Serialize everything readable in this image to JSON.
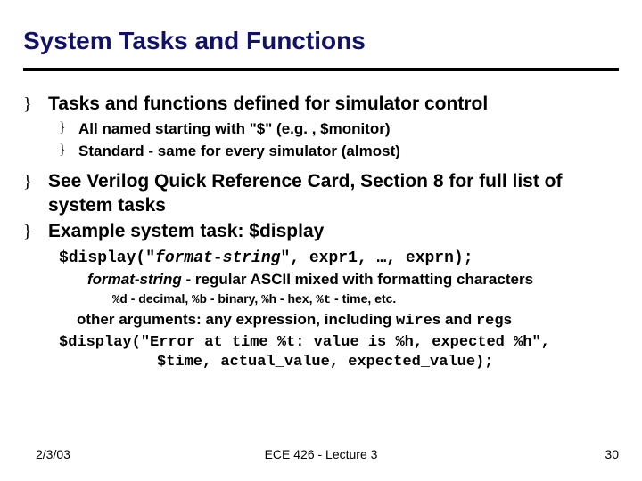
{
  "title": "System Tasks and Functions",
  "items": {
    "i1": "Tasks and functions defined for simulator control",
    "i1a": "All named starting with \"$\" (e.g. , $monitor)",
    "i1b": "Standard - same for every simulator (almost)",
    "i2": "See Verilog Quick Reference Card, Section 8 for full list of system tasks",
    "i3": "Example system task: $display"
  },
  "code": {
    "display_sig_pre": "$display(\"",
    "display_sig_it": "format-string",
    "display_sig_post": "\", expr1, …, exprn);",
    "fmt_label_it": "format-string",
    "fmt_label_rest": " - regular ASCII mixed with formatting characters",
    "fmt_examples_d": "%d",
    "fmt_examples_d2": " - decimal, ",
    "fmt_examples_b": "%b",
    "fmt_examples_b2": " - binary, ",
    "fmt_examples_h": "%h",
    "fmt_examples_h2": " - hex, ",
    "fmt_examples_t": "%t",
    "fmt_examples_t2": " - time, etc.",
    "other_pre": "other arguments: any expression, including ",
    "other_wire": "wire",
    "other_mid": "s and ",
    "other_reg": "reg",
    "other_post": "s",
    "example_l1": "$display(\"Error at time %t: value is %h, expected %h\",",
    "example_l2": "$time, actual_value, expected_value);"
  },
  "footer": {
    "date": "2/3/03",
    "center": "ECE 426 - Lecture 3",
    "page": "30"
  }
}
